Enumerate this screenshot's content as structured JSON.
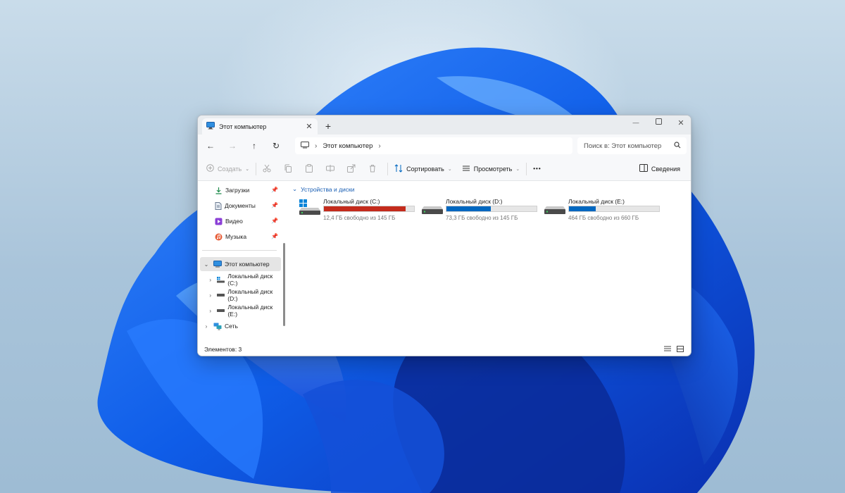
{
  "window": {
    "tab_title": "Этот компьютер",
    "tab_close": "✕",
    "new_tab": "+",
    "minimize": "—",
    "close": "✕"
  },
  "nav": {
    "back": "←",
    "forward": "→",
    "up": "↑",
    "refresh": "↻",
    "address_path": "Этот компьютер",
    "search_placeholder": "Поиск в: Этот компьютер"
  },
  "toolbar": {
    "create_label": "Создать",
    "sort_label": "Сортировать",
    "view_label": "Просмотреть",
    "more_label": "•••",
    "details_label": "Сведения"
  },
  "sidebar": {
    "quick_access": [
      {
        "label": "Загрузки",
        "icon": "download-icon"
      },
      {
        "label": "Документы",
        "icon": "documents-icon"
      },
      {
        "label": "Видео",
        "icon": "video-icon"
      },
      {
        "label": "Музыка",
        "icon": "music-icon"
      }
    ],
    "this_pc_label": "Этот компьютер",
    "drives": [
      {
        "label": "Локальный диск (C:)"
      },
      {
        "label": "Локальный диск (D:)"
      },
      {
        "label": "Локальный диск (E:)"
      }
    ],
    "network_label": "Сеть"
  },
  "main": {
    "section_title": "Устройства и диски",
    "drives": [
      {
        "name": "Локальный диск (C:)",
        "free_text": "12,4 ГБ свободно из 145 ГБ",
        "used_fraction": 0.91,
        "bar_color": "#c42b1c",
        "icon": "windows-drive-icon"
      },
      {
        "name": "Локальный диск (D:)",
        "free_text": "73,3 ГБ свободно из 145 ГБ",
        "used_fraction": 0.49,
        "bar_color": "#0067c0",
        "icon": "hard-drive-icon"
      },
      {
        "name": "Локальный диск (E:)",
        "free_text": "464 ГБ свободно из 660 ГБ",
        "used_fraction": 0.3,
        "bar_color": "#0067c0",
        "icon": "hard-drive-icon"
      }
    ]
  },
  "status": {
    "items_count": "Элементов: 3"
  },
  "colors": {
    "accent": "#0067c0",
    "warning_bar": "#c42b1c"
  }
}
